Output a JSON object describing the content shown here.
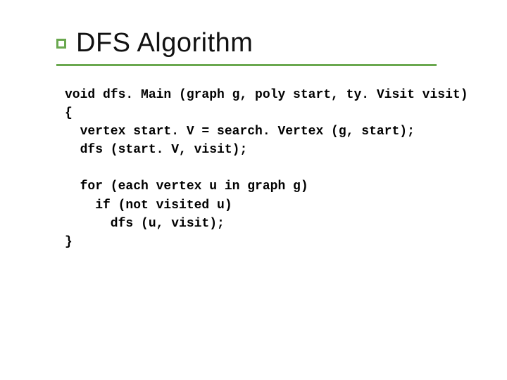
{
  "slide": {
    "title": "DFS Algorithm",
    "code_line_1": "void dfs. Main (graph g, poly start, ty. Visit visit)",
    "code_line_2": "{",
    "code_line_3": "  vertex start. V = search. Vertex (g, start);",
    "code_line_4": "  dfs (start. V, visit);",
    "code_line_5": "",
    "code_line_6": "  for (each vertex u in graph g)",
    "code_line_7": "    if (not visited u)",
    "code_line_8": "      dfs (u, visit);",
    "code_line_9": "}"
  }
}
